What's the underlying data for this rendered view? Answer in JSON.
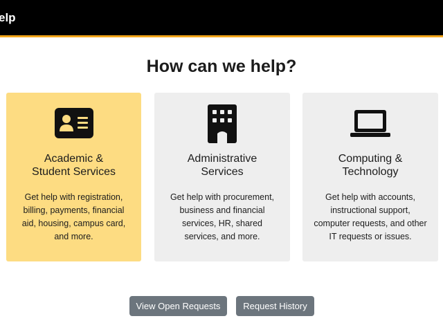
{
  "header": {
    "title": "elp"
  },
  "main": {
    "heading": "How can we help?",
    "cards": [
      {
        "title_line1": "Academic &",
        "title_line2": "Student Services",
        "desc_lines": [
          "Get help with registration,",
          "billing, payments, financial",
          "aid, housing, campus card,",
          "and more."
        ],
        "icon": "id-card-icon"
      },
      {
        "title_line1": "Administrative",
        "title_line2": "Services",
        "desc_lines": [
          "Get help with procurement,",
          "business and financial",
          "services, HR, shared",
          "services, and more."
        ],
        "icon": "building-icon"
      },
      {
        "title_line1": "Computing &",
        "title_line2": "Technology",
        "desc_lines": [
          "Get help with accounts,",
          "instructional support,",
          "computer requests, and other",
          "IT requests or issues."
        ],
        "icon": "laptop-icon"
      }
    ],
    "buttons": {
      "open_requests": "View Open Requests",
      "request_history": "Request History"
    }
  },
  "colors": {
    "header_bg": "#000000",
    "header_accent": "#f2a51a",
    "highlight_card": "#fddc82",
    "card_bg": "#eeeeee",
    "button_bg": "#6c757d"
  }
}
